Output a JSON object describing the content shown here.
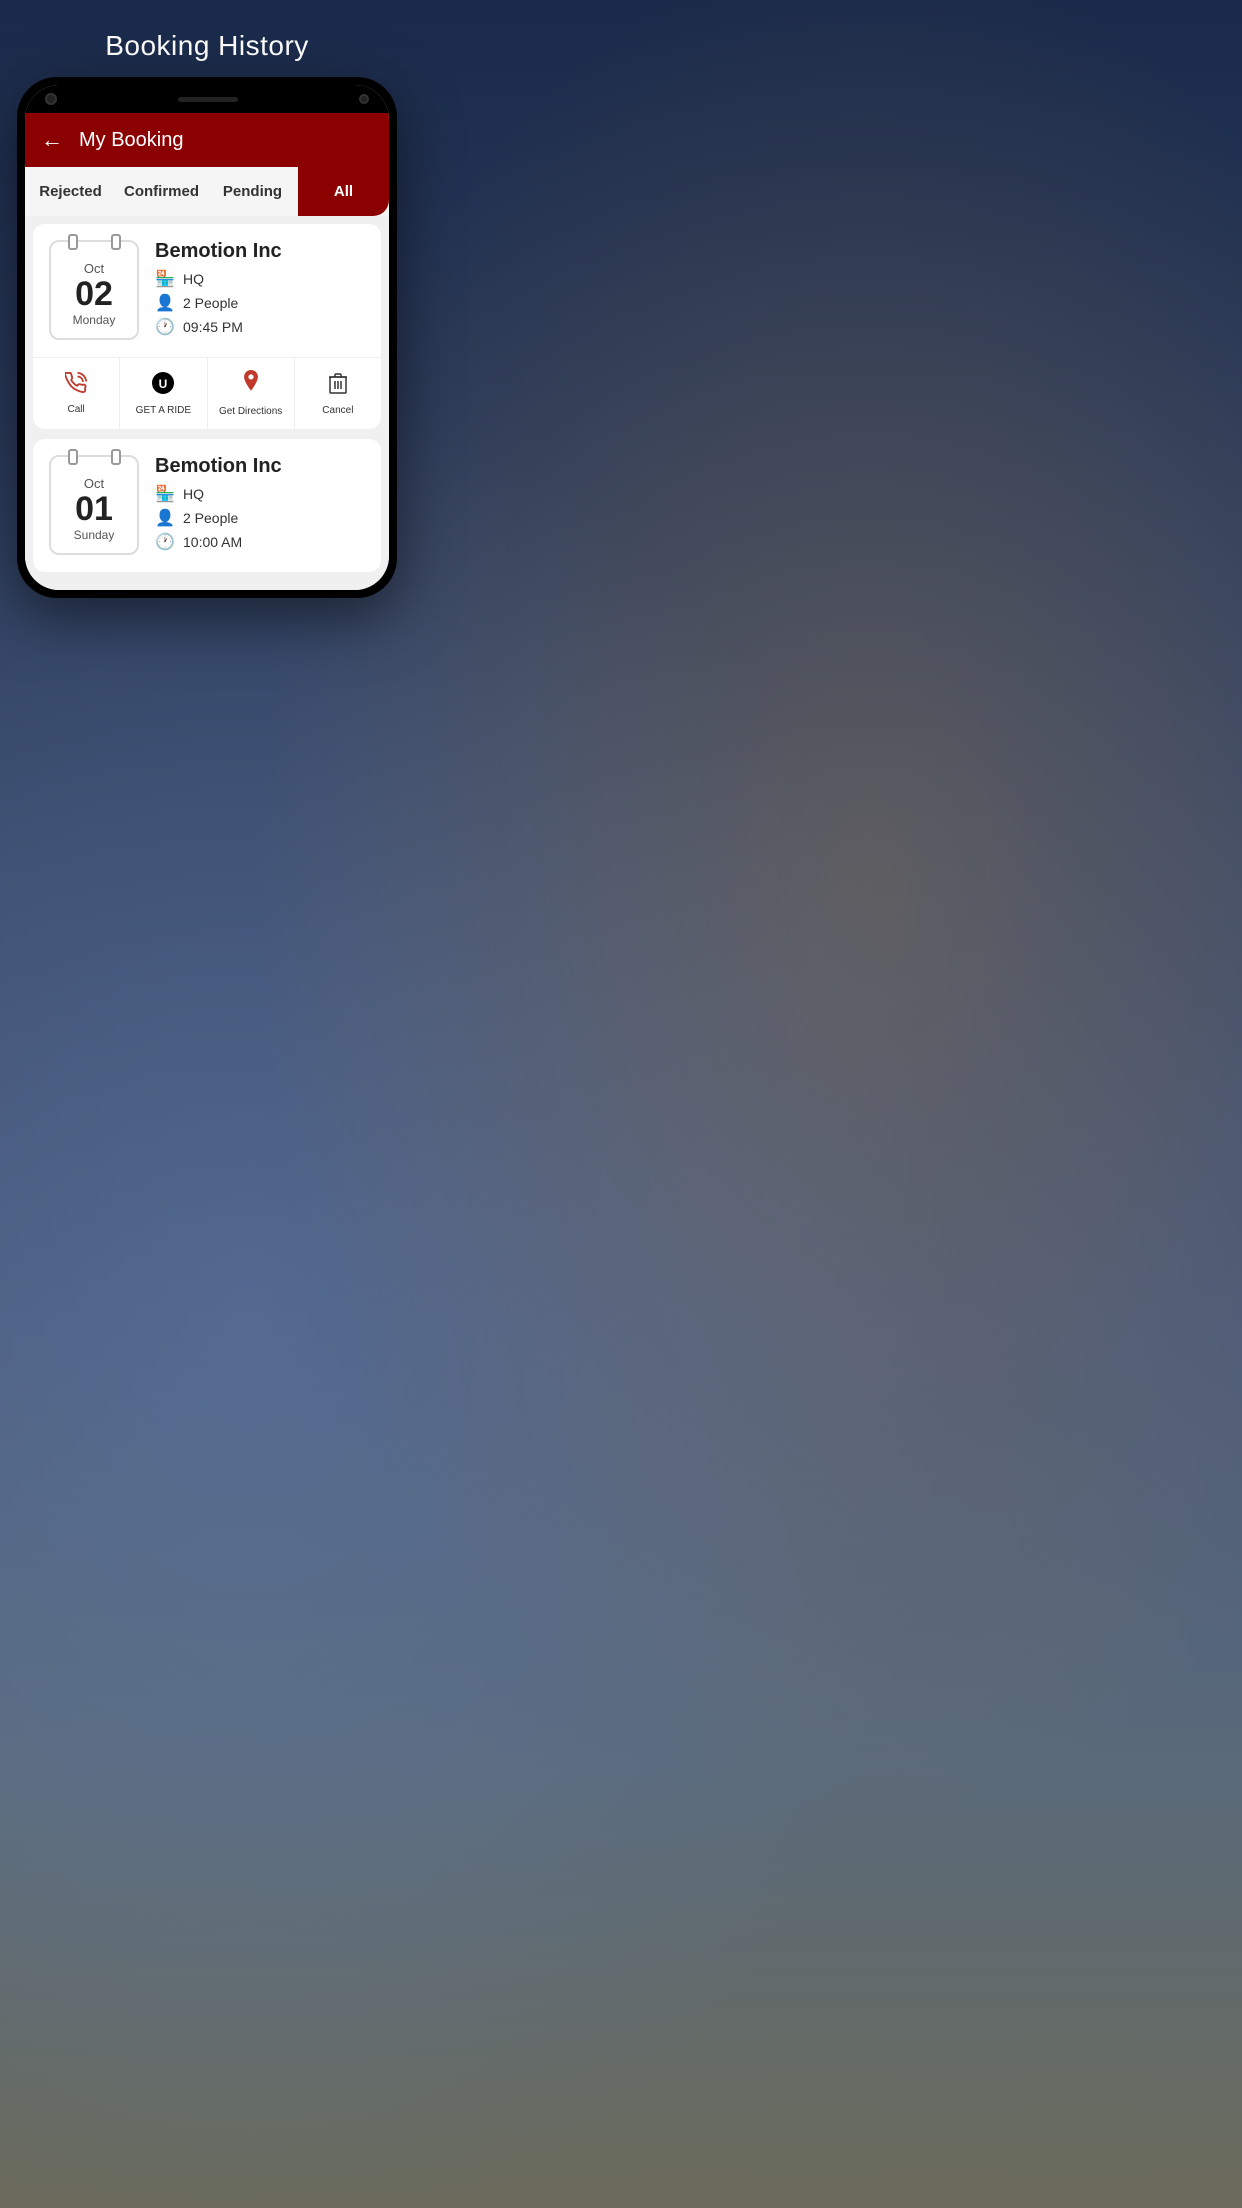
{
  "page": {
    "title": "Booking History"
  },
  "header": {
    "title": "My Booking",
    "back_label": "←"
  },
  "tabs": [
    {
      "id": "rejected",
      "label": "Rejected",
      "active": false
    },
    {
      "id": "confirmed",
      "label": "Confirmed",
      "active": false
    },
    {
      "id": "pending",
      "label": "Pending",
      "active": false
    },
    {
      "id": "all",
      "label": "All",
      "active": true
    }
  ],
  "bookings": [
    {
      "id": 1,
      "calendar": {
        "month": "Oct",
        "day": "02",
        "weekday": "Monday"
      },
      "name": "Bemotion Inc",
      "location": "HQ",
      "people": "2 People",
      "time": "09:45 PM"
    },
    {
      "id": 2,
      "calendar": {
        "month": "Oct",
        "day": "01",
        "weekday": "Sunday"
      },
      "name": "Bemotion Inc",
      "location": "HQ",
      "people": "2 People",
      "time": "10:00 AM"
    }
  ],
  "actions": [
    {
      "id": "call",
      "label": "Call",
      "icon": "call"
    },
    {
      "id": "ride",
      "label": "GET A RIDE",
      "icon": "uber"
    },
    {
      "id": "directions",
      "label": "Get Directions",
      "icon": "pin"
    },
    {
      "id": "cancel",
      "label": "Cancel",
      "icon": "trash"
    }
  ]
}
